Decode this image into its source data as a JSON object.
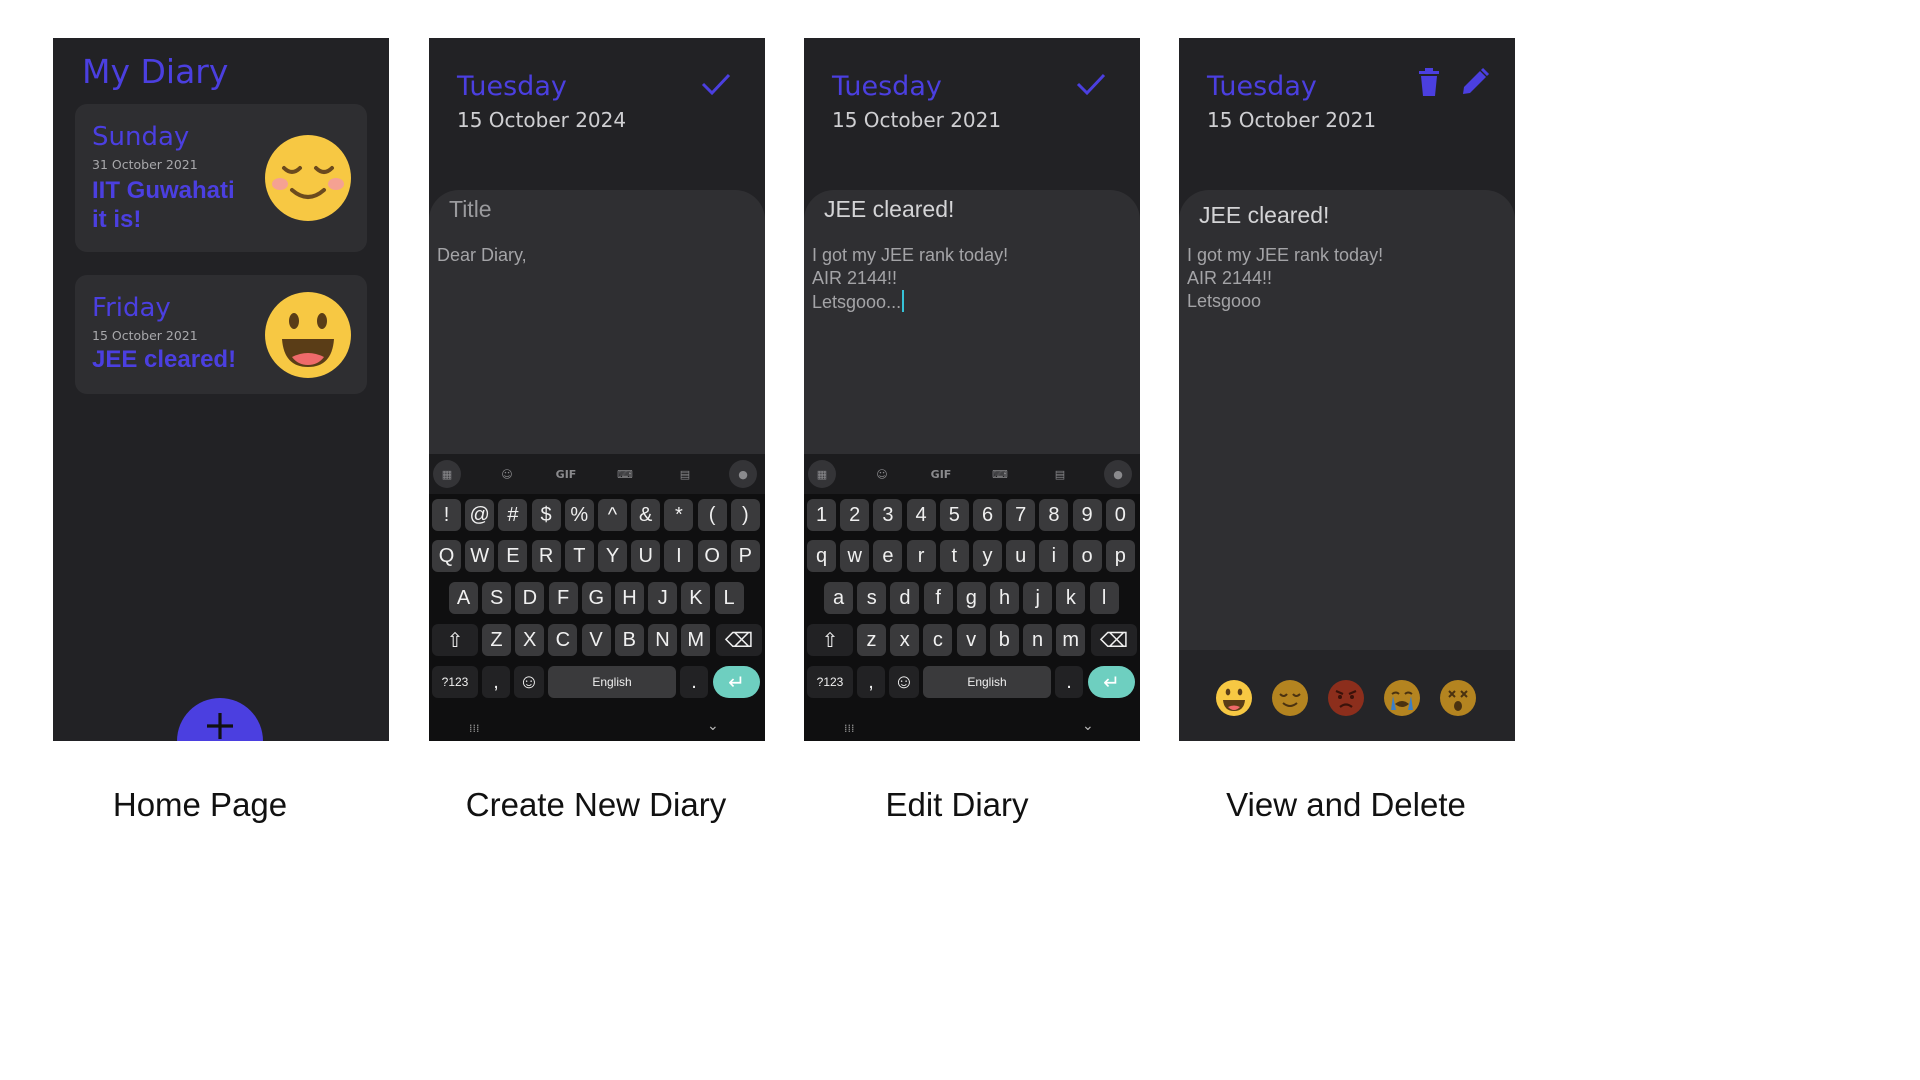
{
  "captions": [
    "Home Page",
    "Create New Diary",
    "Edit Diary",
    "View and Delete"
  ],
  "home": {
    "title": "My Diary",
    "entries": [
      {
        "day": "Sunday",
        "date": "31 October 2021",
        "title": "IIT Guwahati it is!",
        "mood_icon": "content-face-icon"
      },
      {
        "day": "Friday",
        "date": "15 October 2021",
        "title": "JEE cleared!",
        "mood_icon": "happy-face-icon"
      }
    ],
    "fab_icon": "plus-icon"
  },
  "create": {
    "day": "Tuesday",
    "date": "15 October 2024",
    "title_placeholder": "Title",
    "body_placeholder": "Dear Diary,",
    "confirm_icon": "check-icon"
  },
  "edit": {
    "day": "Tuesday",
    "date": "15 October 2021",
    "title": "JEE cleared!",
    "body": "I got my JEE rank today!\nAIR 2144!!\nLetsgooo...",
    "confirm_icon": "check-icon"
  },
  "view": {
    "day": "Tuesday",
    "date": "15 October 2021",
    "title": "JEE cleared!",
    "body": "I got my JEE rank today!\nAIR 2144!!\nLetsgooo",
    "icons": [
      "trash-icon",
      "pencil-icon"
    ],
    "moods": [
      "happy-face-icon",
      "content-face-icon",
      "angry-face-icon",
      "crying-face-icon",
      "shocked-face-icon"
    ]
  },
  "keyboard_symbols": {
    "toolbar": [
      "apps-icon",
      "sticker-icon",
      "GIF",
      "keyboard-icon",
      "clipboard-icon",
      "mic-icon"
    ],
    "row1": [
      "!",
      "@",
      "#",
      "$",
      "%",
      "^",
      "&",
      "*",
      "(",
      ")"
    ],
    "row2": [
      "Q",
      "W",
      "E",
      "R",
      "T",
      "Y",
      "U",
      "I",
      "O",
      "P"
    ],
    "row3": [
      "A",
      "S",
      "D",
      "F",
      "G",
      "H",
      "J",
      "K",
      "L"
    ],
    "row4": [
      "Z",
      "X",
      "C",
      "V",
      "B",
      "N",
      "M"
    ],
    "mode_key": "?123",
    "comma": ",",
    "space": "English",
    "period": "."
  },
  "keyboard_numbers": {
    "toolbar": [
      "apps-icon",
      "sticker-icon",
      "GIF",
      "keyboard-icon",
      "clipboard-icon",
      "mic-icon"
    ],
    "row1": [
      "1",
      "2",
      "3",
      "4",
      "5",
      "6",
      "7",
      "8",
      "9",
      "0"
    ],
    "row2": [
      "q",
      "w",
      "e",
      "r",
      "t",
      "y",
      "u",
      "i",
      "o",
      "p"
    ],
    "row3": [
      "a",
      "s",
      "d",
      "f",
      "g",
      "h",
      "j",
      "k",
      "l"
    ],
    "row4": [
      "z",
      "x",
      "c",
      "v",
      "b",
      "n",
      "m"
    ],
    "mode_key": "?123",
    "comma": ",",
    "space": "English",
    "period": "."
  },
  "colors": {
    "accent": "#4b3fe0",
    "screen_bg": "#222225",
    "panel_bg": "#2f2f32",
    "enter_key": "#6ecfc0",
    "emoji_yellow": "#f7c843"
  }
}
